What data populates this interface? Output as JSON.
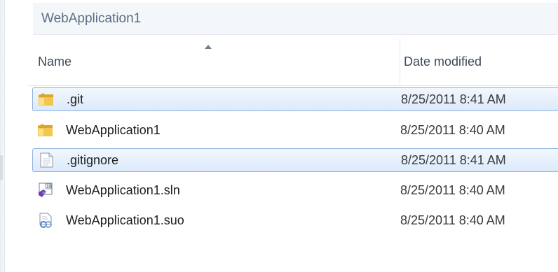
{
  "breadcrumb": {
    "current": "WebApplication1"
  },
  "columns": {
    "name": "Name",
    "date_modified": "Date modified"
  },
  "files": [
    {
      "name": ".git",
      "date": "8/25/2011 8:41 AM",
      "icon": "folder-icon",
      "selected": true
    },
    {
      "name": "WebApplication1",
      "date": "8/25/2011 8:40 AM",
      "icon": "folder-icon",
      "selected": false
    },
    {
      "name": ".gitignore",
      "date": "8/25/2011 8:41 AM",
      "icon": "text-file-icon",
      "selected": true
    },
    {
      "name": "WebApplication1.sln",
      "date": "8/25/2011 8:40 AM",
      "icon": "vs-solution-icon",
      "selected": false
    },
    {
      "name": "WebApplication1.suo",
      "date": "8/25/2011 8:40 AM",
      "icon": "vs-user-options-icon",
      "selected": false
    }
  ],
  "colors": {
    "selection_border": "#8fb3dd",
    "selection_fill": "#dceafb",
    "folder": "#e8b83c"
  }
}
